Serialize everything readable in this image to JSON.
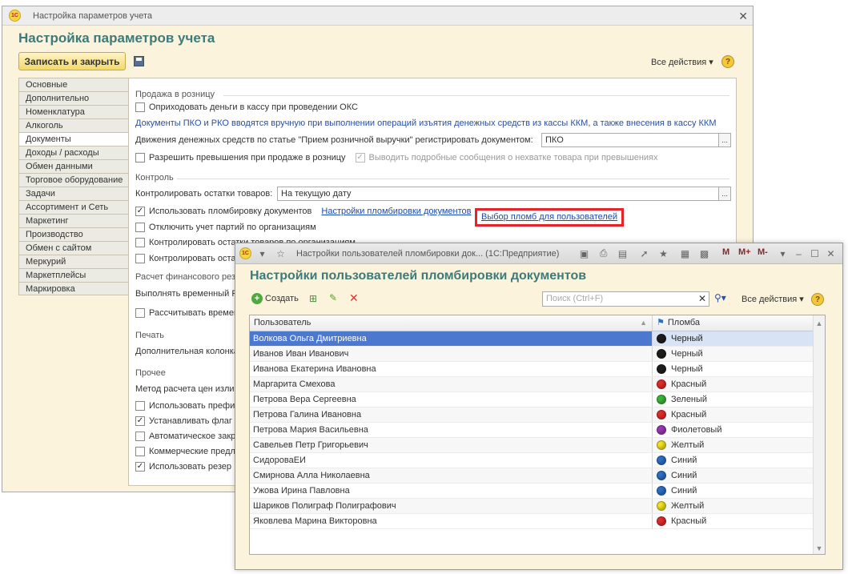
{
  "main_window": {
    "titlebar": "Настройка параметров учета",
    "title": "Настройка параметров учета",
    "save_close": "Записать и закрыть",
    "all_actions": "Все действия ▾",
    "help": "?",
    "sidebar": [
      "Основные",
      "Дополнительно",
      "Номенклатура",
      "Алкоголь",
      "Документы",
      "Доходы / расходы",
      "Обмен данными",
      "Торговое оборудование",
      "Задачи",
      "Ассортимент и Сеть",
      "Маркетинг",
      "Производство",
      "Обмен с сайтом",
      "Меркурий",
      "Маркетплейсы",
      "Маркировка"
    ],
    "sidebar_selected": "Документы",
    "retail": {
      "section": "Продажа в розницу",
      "cb_ooks": "Оприходовать деньги в кассу при проведении ОКС",
      "info": "Документы ПКО и РКО вводятся вручную при выполнении операций изъятия денежных средств из кассы ККМ, а также внесения в кассу ККМ",
      "movement_label": "Движения денежных средств по статье \"Прием розничной выручки\" регистрировать документом:",
      "movement_value": "ПКО",
      "cb_excess": "Разрешить превышения при продаже в розницу",
      "cb_messages": "Выводить подробные сообщения о нехватке товара при превышениях"
    },
    "control": {
      "section": "Контроль",
      "stock_label": "Контролировать остатки товаров:",
      "stock_value": "На текущую дату",
      "cb_seal": "Использовать пломбировку документов",
      "link_seal_settings": "Настройки пломбировки документов",
      "link_seal_users": "Выбор пломб для пользователей",
      "cb_batches": "Отключить учет партий по организациям",
      "cb_stock_org": "Контролировать остатки товаров по организациям",
      "cb_stock_partial": "Контролировать оста"
    },
    "fin": {
      "section": "Расчет финансового рез",
      "exec": "Выполнять временный Р",
      "cb_calc": "Рассчитывать времен"
    },
    "print": {
      "section": "Печать",
      "extra": "Дополнительная колонка"
    },
    "other": {
      "section": "Прочее",
      "method": "Метод расчета цен излиш",
      "cb1": "Использовать префи",
      "cb2": "Устанавливать флаг",
      "cb3": "Автоматическое закр",
      "cb4": "Коммерческие предл",
      "cb5": "Использовать резер"
    }
  },
  "dialog": {
    "titlebar": "Настройки пользователей пломбировки док...  (1С:Предприятие)",
    "title": "Настройки пользователей пломбировки документов",
    "create": "Создать",
    "search_placeholder": "Поиск (Ctrl+F)",
    "all_actions": "Все действия ▾",
    "help": "?",
    "mbtns": [
      "M",
      "M+",
      "M-"
    ],
    "columns": [
      "Пользователь",
      "Пломба"
    ],
    "rows": [
      {
        "user": "Волкова Ольга Дмитриевна",
        "seal": "Черный",
        "color": "#1e1e1e"
      },
      {
        "user": "Иванов Иван Иванович",
        "seal": "Черный",
        "color": "#1e1e1e"
      },
      {
        "user": "Иванова Екатерина Ивановна",
        "seal": "Черный",
        "color": "#1e1e1e"
      },
      {
        "user": "Маргарита Смехова",
        "seal": "Красный",
        "color": "#e32b2b"
      },
      {
        "user": "Петрова Вера Сергеевна",
        "seal": "Зеленый",
        "color": "#3cb63a"
      },
      {
        "user": "Петрова Галина Ивановна",
        "seal": "Красный",
        "color": "#e32b2b"
      },
      {
        "user": "Петрова Мария Васильевна",
        "seal": "Фиолетовый",
        "color": "#9a37b5"
      },
      {
        "user": "Савельев Петр Григорьевич",
        "seal": "Желтый",
        "color": "#f2e220"
      },
      {
        "user": "СидороваЕИ",
        "seal": "Синий",
        "color": "#2b6fc9"
      },
      {
        "user": "Смирнова Алла Николаевна",
        "seal": "Синий",
        "color": "#2b6fc9"
      },
      {
        "user": "Ужова Ирина Павловна",
        "seal": "Синий",
        "color": "#2b6fc9"
      },
      {
        "user": "Шариков Полиграф Полиграфович",
        "seal": "Желтый",
        "color": "#f2e220"
      },
      {
        "user": "Яковлева Марина Викторовна",
        "seal": "Красный",
        "color": "#e32b2b"
      }
    ]
  }
}
